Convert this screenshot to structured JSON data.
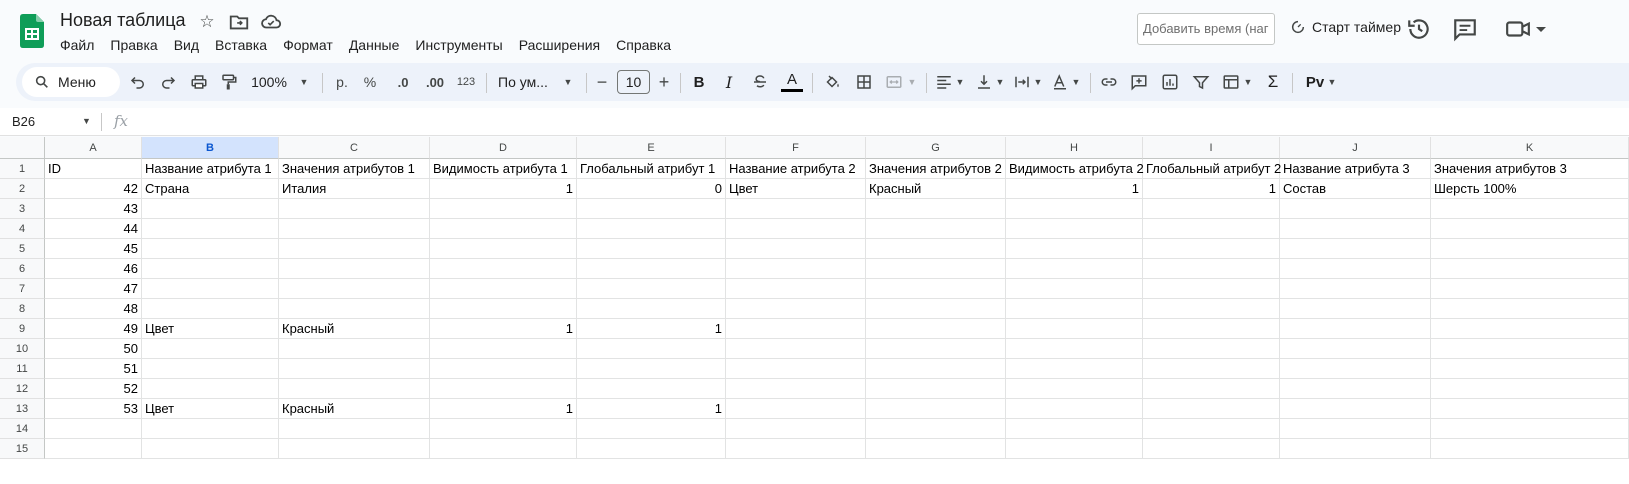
{
  "app": {
    "title": "Новая таблица",
    "menu": [
      "Файл",
      "Правка",
      "Вид",
      "Вставка",
      "Формат",
      "Данные",
      "Инструменты",
      "Расширения",
      "Справка"
    ],
    "time_input_placeholder": "Добавить время (наг",
    "timer_label": "Старт таймер",
    "colors": {
      "brand_green": "#0f9d58",
      "toolbar_bg": "#edf2fa",
      "selected_header": "#d3e3fd"
    }
  },
  "toolbar": {
    "search_label": "Меню",
    "zoom": "100%",
    "currency": "р.",
    "percent": "%",
    "dec_decrease": ".0",
    "dec_increase": ".00",
    "number_format": "123",
    "font": "По ум...",
    "font_size": "10",
    "bold": "B",
    "italic": "I",
    "text_color": "A",
    "sum": "Σ",
    "script_label": "Pv"
  },
  "formula_bar": {
    "cell_ref": "B26",
    "fx": "fx"
  },
  "sheet": {
    "columns": [
      "A",
      "B",
      "C",
      "D",
      "E",
      "F",
      "G",
      "H",
      "I",
      "J",
      "K"
    ],
    "selected_column": "B",
    "row_numbers": [
      "1",
      "2",
      "3",
      "4",
      "5",
      "6",
      "7",
      "8",
      "9",
      "10",
      "11",
      "12",
      "13",
      "14",
      "15"
    ],
    "rows": [
      [
        "ID",
        "Название атрибута 1",
        "Значения атрибутов 1",
        "Видимость атрибута 1",
        "Глобальный атрибут 1",
        "Название атрибута 2",
        "Значения атрибутов 2",
        "Видимость атрибута 2",
        "Глобальный атрибут 2",
        "Название атрибута 3",
        "Значения атрибутов 3"
      ],
      [
        "42",
        "Страна",
        "Италия",
        "1",
        "0",
        "Цвет",
        "Красный",
        "1",
        "1",
        "Состав",
        "Шерсть 100%"
      ],
      [
        "43",
        "",
        "",
        "",
        "",
        "",
        "",
        "",
        "",
        "",
        ""
      ],
      [
        "44",
        "",
        "",
        "",
        "",
        "",
        "",
        "",
        "",
        "",
        ""
      ],
      [
        "45",
        "",
        "",
        "",
        "",
        "",
        "",
        "",
        "",
        "",
        ""
      ],
      [
        "46",
        "",
        "",
        "",
        "",
        "",
        "",
        "",
        "",
        "",
        ""
      ],
      [
        "47",
        "",
        "",
        "",
        "",
        "",
        "",
        "",
        "",
        "",
        ""
      ],
      [
        "48",
        "",
        "",
        "",
        "",
        "",
        "",
        "",
        "",
        "",
        ""
      ],
      [
        "49",
        "Цвет",
        "Красный",
        "1",
        "1",
        "",
        "",
        "",
        "",
        "",
        ""
      ],
      [
        "50",
        "",
        "",
        "",
        "",
        "",
        "",
        "",
        "",
        "",
        ""
      ],
      [
        "51",
        "",
        "",
        "",
        "",
        "",
        "",
        "",
        "",
        "",
        ""
      ],
      [
        "52",
        "",
        "",
        "",
        "",
        "",
        "",
        "",
        "",
        "",
        ""
      ],
      [
        "53",
        "Цвет",
        "Красный",
        "1",
        "1",
        "",
        "",
        "",
        "",
        "",
        ""
      ],
      [
        "",
        "",
        "",
        "",
        "",
        "",
        "",
        "",
        "",
        "",
        ""
      ],
      [
        "",
        "",
        "",
        "",
        "",
        "",
        "",
        "",
        "",
        "",
        ""
      ]
    ]
  }
}
